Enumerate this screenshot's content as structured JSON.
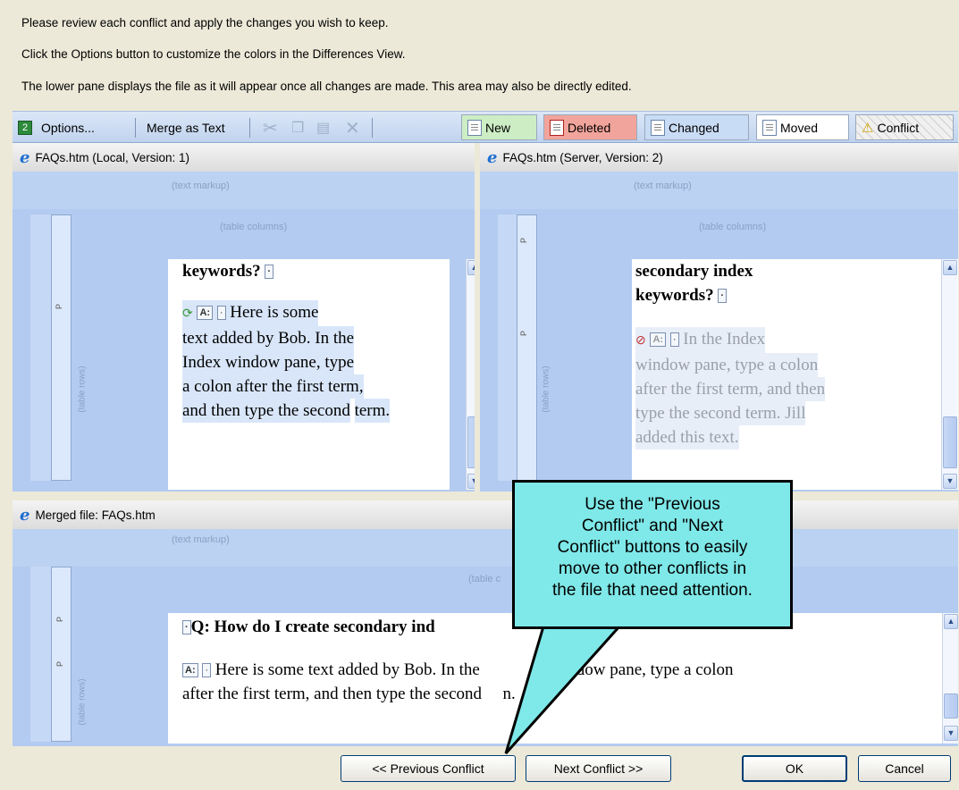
{
  "instructions": [
    "Please review each conflict and apply the changes you wish to keep.",
    "Click the Options button to customize the colors in the Differences View.",
    "The lower pane displays the file as it will appear once all changes are made. This area may also be directly edited."
  ],
  "toolbar": {
    "options_label": "Options...",
    "merge_text_label": "Merge as Text",
    "legend": {
      "new": "New",
      "deleted": "Deleted",
      "changed": "Changed",
      "moved": "Moved",
      "conflict": "Conflict"
    },
    "colors": {
      "new": "#cdeec5",
      "deleted": "#f1a49b",
      "changed": "#c9dcf5",
      "moved": "#ffffff",
      "conflict": "#f0f0f0"
    }
  },
  "panes": {
    "local": {
      "title": "FAQs.htm (Local, Version: 1)",
      "text_markup": "(text markup)",
      "table_columns": "(table columns)",
      "table_rows": "(table rows)",
      "p_mark": "P",
      "heading": "keywords?",
      "answer_tag": "A:",
      "answer_lines": [
        "Here is some",
        "text added by Bob. In the",
        "Index window pane, type",
        "a colon after the first term,",
        "and then type the second",
        "term."
      ]
    },
    "server": {
      "title": "FAQs.htm (Server, Version: 2)",
      "text_markup": "(text markup)",
      "table_columns": "(table columns)",
      "table_rows": "(table rows)",
      "p_mark": "P",
      "heading_lines": [
        "secondary index",
        "keywords?"
      ],
      "answer_tag": "A:",
      "answer_lines": [
        "In the Index",
        "window pane, type a colon",
        "after the first term, and then",
        "type the second term. Jill",
        "added this text."
      ]
    },
    "merged": {
      "title": "Merged file: FAQs.htm",
      "text_markup": "(text markup)",
      "table_columns": "(table c",
      "table_rows": "(table rows)",
      "p_mark": "P",
      "question_tag": "Q:",
      "question": "How do I create secondary ind",
      "answer_tag": "A:",
      "answer_line1_a": "Here is some text added by Bob. In the",
      "answer_line1_b": "window pane, type a colon",
      "answer_line2_a": "after the first term, and then type the second",
      "answer_line2_b": "n."
    }
  },
  "callout": {
    "lines": [
      "Use the \"Previous",
      "Conflict\" and \"Next",
      "Conflict\" buttons to easily",
      "move to other conflicts in",
      "the file that need attention."
    ]
  },
  "buttons": {
    "previous": "<< Previous Conflict",
    "next": "Next Conflict >>",
    "ok": "OK",
    "cancel": "Cancel"
  }
}
